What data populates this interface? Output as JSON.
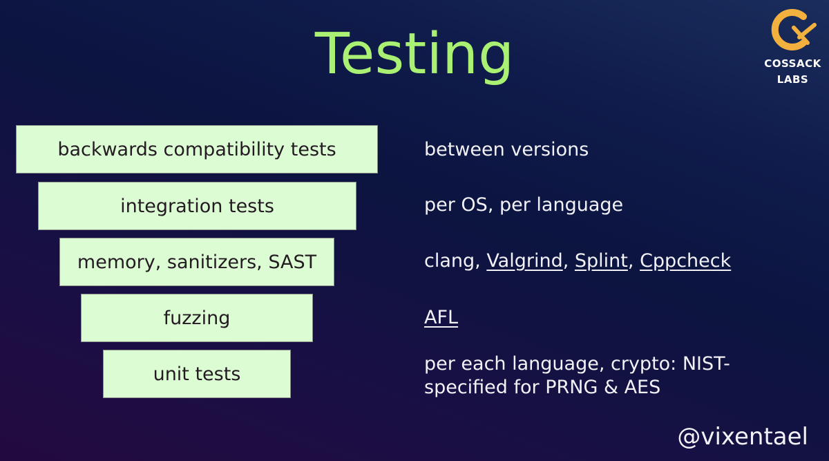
{
  "slide": {
    "title": "Testing",
    "logo": {
      "icon": "cossack-labs-cx-icon",
      "line1": "COSSACK",
      "line2": "LABS",
      "accent_color": "#f2b13f"
    },
    "title_color": "#a9f073",
    "pyramid": [
      {
        "label": "backwards compatibility tests"
      },
      {
        "label": "integration tests"
      },
      {
        "label": "memory, sanitizers, SAST"
      },
      {
        "label": "fuzzing"
      },
      {
        "label": "unit tests"
      }
    ],
    "descriptions": {
      "row0": {
        "text": "between versions"
      },
      "row1": {
        "text": "per OS, per language"
      },
      "row2": {
        "prefix": "clang, ",
        "links": [
          "Valgrind",
          "Splint",
          "Cppcheck"
        ],
        "sep": ", "
      },
      "row3": {
        "links": [
          "AFL"
        ]
      },
      "row4": {
        "line1": "per each language, crypto: NIST-",
        "line2": "specified for PRNG & AES"
      }
    },
    "handle": "@vixentael"
  }
}
